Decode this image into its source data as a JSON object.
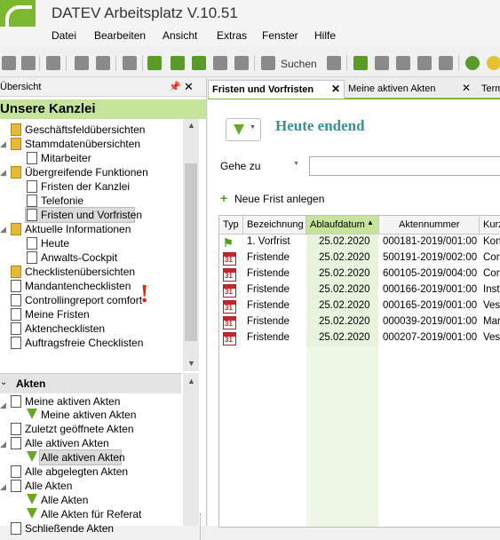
{
  "app": {
    "title": "DATEV Arbeitsplatz V.10.51"
  },
  "menu": [
    "Datei",
    "Bearbeiten",
    "Ansicht",
    "Extras",
    "Fenster",
    "Hilfe"
  ],
  "toolbar": {
    "search_label": "Suchen"
  },
  "left_panel": {
    "header": "Übersicht",
    "kanzlei_title": "Unsere Kanzlei",
    "tree": [
      {
        "label": "Geschäftsfeldübersichten",
        "icon": "folder-icon"
      },
      {
        "label": "Stammdatenübersichten",
        "icon": "folder-icon"
      },
      {
        "label": "Mitarbeiter",
        "icon": "document-icon"
      },
      {
        "label": "Übergreifende Funktionen",
        "icon": "folder-icon"
      },
      {
        "label": "Fristen der Kanzlei",
        "icon": "document-icon"
      },
      {
        "label": "Telefonie",
        "icon": "document-icon"
      },
      {
        "label": "Fristen und Vorfristen",
        "icon": "document-icon"
      },
      {
        "label": "Aktuelle Informationen",
        "icon": "folder-icon"
      },
      {
        "label": "Heute",
        "icon": "document-icon"
      },
      {
        "label": "Anwalts-Cockpit",
        "icon": "document-icon"
      },
      {
        "label": "Checklistenübersichten",
        "icon": "folder-icon"
      },
      {
        "label": "Mandantenchecklisten",
        "icon": "document-icon"
      },
      {
        "label": "Controllingreport comfort",
        "icon": "document-icon"
      },
      {
        "label": "Meine Fristen",
        "icon": "document-icon"
      },
      {
        "label": "Aktenchecklisten",
        "icon": "document-icon"
      },
      {
        "label": "Auftragsfreie Checklisten",
        "icon": "document-icon"
      }
    ],
    "exclamation": "!",
    "akten_header": "Akten",
    "akten_tree": [
      {
        "label": "Meine aktiven Akten",
        "icon": "document-icon"
      },
      {
        "label": "Meine aktiven Akten",
        "icon": "filter-icon"
      },
      {
        "label": "Zuletzt geöffnete Akten",
        "icon": "document-icon"
      },
      {
        "label": "Alle aktiven Akten",
        "icon": "document-icon"
      },
      {
        "label": "Alle aktiven Akten",
        "icon": "filter-icon"
      },
      {
        "label": "Alle abgelegten Akten",
        "icon": "document-icon"
      },
      {
        "label": "Alle Akten",
        "icon": "document-icon"
      },
      {
        "label": "Alle Akten",
        "icon": "filter-icon"
      },
      {
        "label": "Alle Akten für Referat",
        "icon": "filter-icon"
      },
      {
        "label": "Schließende Akten",
        "icon": "document-icon"
      }
    ]
  },
  "tabs": [
    {
      "label": "Fristen und Vorfristen",
      "active": true
    },
    {
      "label": "Meine aktiven Akten",
      "active": false
    },
    {
      "label": "Term",
      "active": false
    }
  ],
  "main": {
    "heading": "Heute endend",
    "goto_label": "Gehe zu",
    "goto_value": "",
    "new_deadline": "Neue Frist anlegen",
    "columns": [
      "Typ",
      "Bezeichnung",
      "Ablaufdatum",
      "Aktennummer",
      "Kurz"
    ],
    "rows": [
      {
        "type": "Vorfrist",
        "label": "1. Vorfrist",
        "date": "25.02.2020",
        "file": "000181-2019/001:00",
        "extra": "Kont"
      },
      {
        "type": "Frist",
        "label": "Fristende",
        "date": "25.02.2020",
        "file": "500191-2019/002:00",
        "extra": "Com"
      },
      {
        "type": "Frist",
        "label": "Fristende",
        "date": "25.02.2020",
        "file": "600105-2019/004:00",
        "extra": "Com"
      },
      {
        "type": "Frist",
        "label": "Fristende",
        "date": "25.02.2020",
        "file": "000166-2019/001:00",
        "extra": "Insto"
      },
      {
        "type": "Frist",
        "label": "Fristende",
        "date": "25.02.2020",
        "file": "000165-2019/001:00",
        "extra": "Vest"
      },
      {
        "type": "Frist",
        "label": "Fristende",
        "date": "25.02.2020",
        "file": "000039-2019/001:00",
        "extra": "Marz"
      },
      {
        "type": "Frist",
        "label": "Fristende",
        "date": "25.02.2020",
        "file": "000207-2019/001:00",
        "extra": "Vest"
      }
    ],
    "calendar_icon_text": "31"
  },
  "colors": {
    "accent_green": "#7cb82f",
    "heading_teal": "#3a8f8f",
    "highlight": "#c5e39a",
    "date_red": "#c4262e"
  }
}
